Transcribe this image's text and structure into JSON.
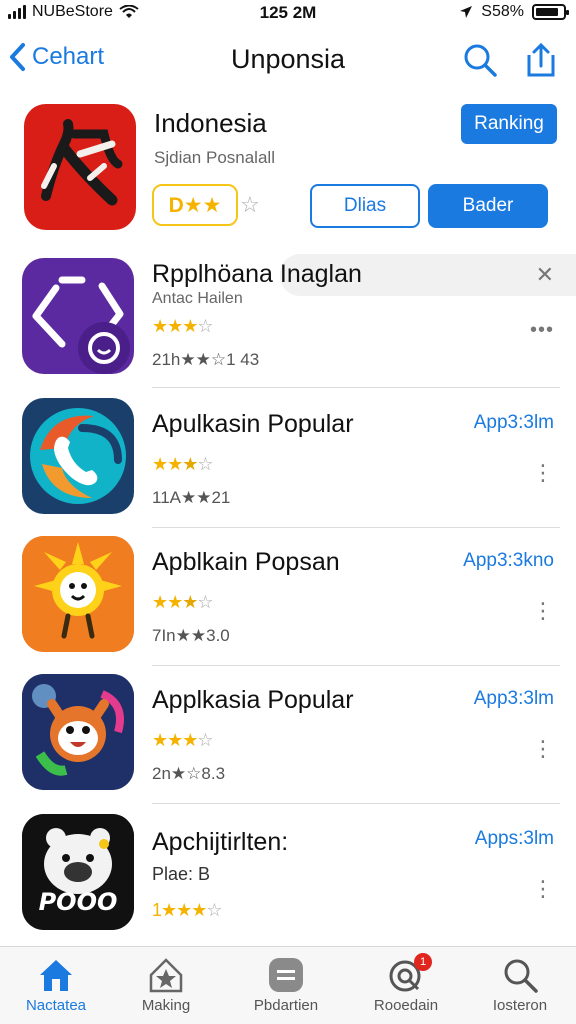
{
  "status": {
    "carrier": "NUBeStore",
    "time": "125 2M",
    "battery": "S58%"
  },
  "nav": {
    "back_label": "Cehart",
    "title": "Unponsia"
  },
  "featured": {
    "title": "Indonesia",
    "subtitle": "Sjdian Posnalall",
    "rank_label": "Ranking",
    "rating_text": "D★★",
    "button_outline": "Dlias",
    "button_solid": "Bader",
    "icon_color": "#d91e18"
  },
  "apps": [
    {
      "name": "Rpplhöana Inaglan",
      "meta": "Antac Hailen",
      "stars": "★★★",
      "stars_empty": "☆",
      "count": "21h★★☆1 43",
      "icon": "refresh-chat-icon",
      "icon_color": "#5b2aa0"
    },
    {
      "name": "Apulkasin Popular",
      "stars": "★★",
      "stars_half": "★",
      "stars_empty": "☆",
      "count": "11A★★21",
      "action": "App3:3lm",
      "icon": "phone-swirl-icon",
      "icon_color": "#1a3f6b"
    },
    {
      "name": "Apblkain Popsan",
      "stars": "★★",
      "stars_half": "★",
      "stars_empty": "☆",
      "count": "7In★★3.0",
      "action": "App3:3kno",
      "icon": "sun-character-icon",
      "icon_color": "#e84e1b"
    },
    {
      "name": "Applkasia Popular",
      "stars": "★★★",
      "stars_empty": "☆",
      "count": "2n★☆8.3",
      "action": "App3:3lm",
      "icon": "fox-character-icon",
      "icon_color": "#253a7a"
    },
    {
      "name": "Apchijtirlten:",
      "meta": "Plae: B",
      "stars": "1★★★",
      "stars_empty": "☆",
      "action": "Apps:3lm",
      "icon": "bear-character-icon",
      "icon_color": "#111111",
      "icon_text": "POOO"
    }
  ],
  "tabs": [
    {
      "label": "Nactatea",
      "icon": "home-icon",
      "active": true
    },
    {
      "label": "Making",
      "icon": "star-house-icon",
      "active": false
    },
    {
      "label": "Pbdartien",
      "icon": "stack-icon",
      "active": false
    },
    {
      "label": "Rooedain",
      "icon": "update-icon",
      "active": false,
      "badge": "1"
    },
    {
      "label": "Iosteron",
      "icon": "search-icon",
      "active": false
    }
  ],
  "colors": {
    "accent": "#1a7ae0",
    "star": "#f5b300"
  }
}
